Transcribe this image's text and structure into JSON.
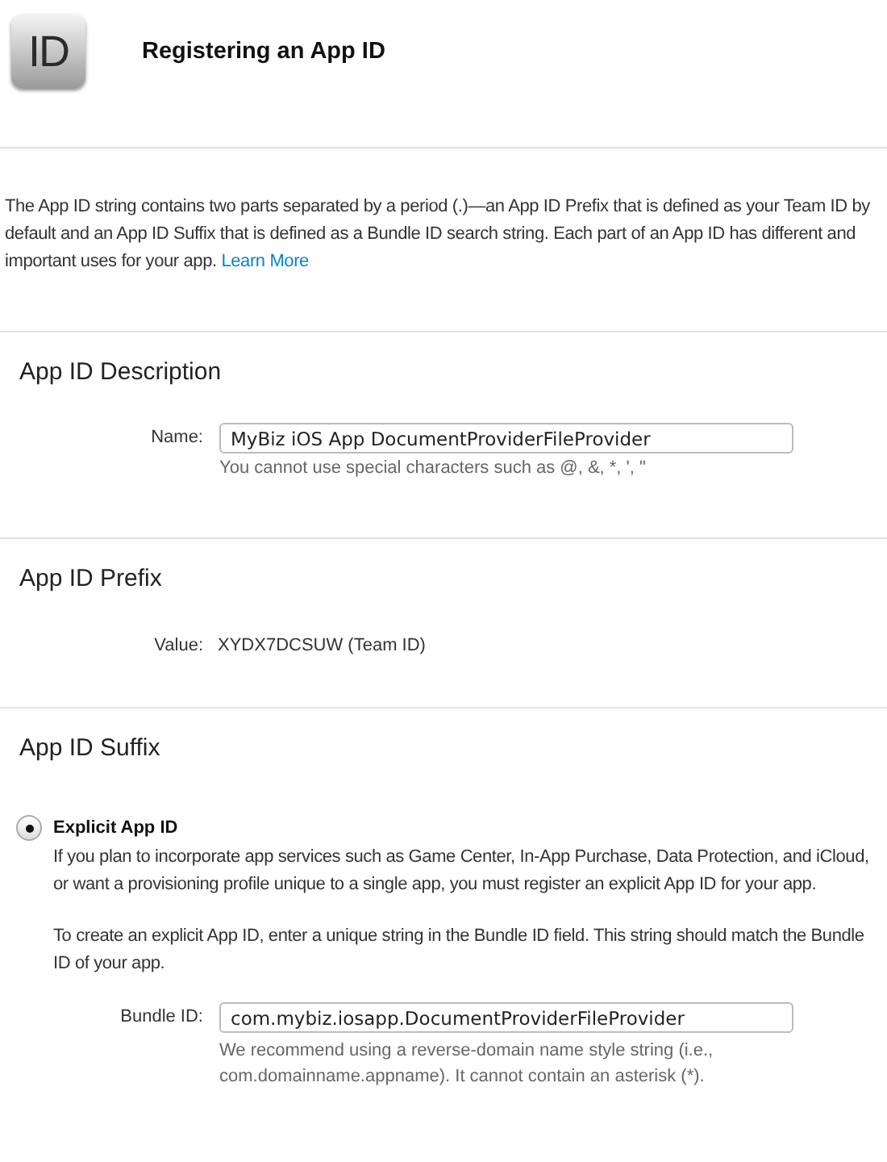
{
  "header": {
    "logo_text": "ID",
    "title": "Registering an App ID"
  },
  "intro": {
    "text": "The App ID string contains two parts separated by a period (.)—an App ID Prefix that is defined as your Team ID by default and an App ID Suffix that is defined as a Bundle ID search string. Each part of an App ID has different and important uses for your app.",
    "link": "Learn More"
  },
  "description_section": {
    "title": "App ID Description",
    "label": "Name:",
    "value": "MyBiz iOS App DocumentProviderFileProvider",
    "hint": "You cannot use special characters such as @, &, *, ', \""
  },
  "prefix_section": {
    "title": "App ID Prefix",
    "label": "Value:",
    "value": "XYDX7DCSUW (Team ID)"
  },
  "suffix_section": {
    "title": "App ID Suffix",
    "option": {
      "label": "Explicit App ID",
      "selected": true
    },
    "paragraphs": [
      "If you plan to incorporate app services such as Game Center, In-App Purchase, Data Protection, and iCloud, or want a provisioning profile unique to a single app, you must register an explicit App ID for your app.",
      "To create an explicit App ID, enter a unique string in the Bundle ID field. This string should match the Bundle ID of your app."
    ],
    "label": "Bundle ID:",
    "value": "com.mybiz.iosapp.DocumentProviderFileProvider",
    "hint": "We recommend using a reverse-domain name style string (i.e., com.domainname.appname). It cannot contain an asterisk (*)."
  }
}
